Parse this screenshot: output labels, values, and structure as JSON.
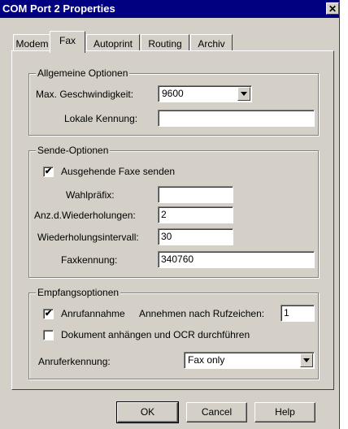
{
  "window": {
    "title": "COM Port 2 Properties",
    "close_glyph": "✕"
  },
  "tabs": [
    {
      "label": "Modem",
      "selected": false
    },
    {
      "label": "Fax",
      "selected": true
    },
    {
      "label": "Autoprint",
      "selected": false
    },
    {
      "label": "Routing",
      "selected": false
    },
    {
      "label": "Archiv",
      "selected": false
    }
  ],
  "general": {
    "title": "Allgemeine Optionen",
    "max_speed_label": "Max. Geschwindigkeit:",
    "max_speed_value": "9600",
    "local_id_label": "Lokale Kennung:",
    "local_id_value": ""
  },
  "send": {
    "title": "Sende-Optionen",
    "send_check_label": "Ausgehende Faxe senden",
    "send_checked": true,
    "dial_prefix_label": "Wahlpräfix:",
    "dial_prefix_value": "",
    "retries_label": "Anz.d.Wiederholungen:",
    "retries_value": "2",
    "retry_interval_label": "Wiederholungsintervall:",
    "retry_interval_value": "30",
    "fax_id_label": "Faxkennung:",
    "fax_id_value": "340760"
  },
  "receive": {
    "title": "Empfangsoptionen",
    "answer_check_label": "Anrufannahme",
    "answer_checked": true,
    "rings_label": "Annehmen nach Rufzeichen:",
    "rings_value": "1",
    "ocr_check_label": "Dokument anhängen und OCR durchführen",
    "ocr_checked": false,
    "caller_id_label": "Anruferkennung:",
    "caller_id_value": "Fax only"
  },
  "buttons": {
    "ok": "OK",
    "cancel": "Cancel",
    "help": "Help"
  },
  "check_glyph": "✔"
}
